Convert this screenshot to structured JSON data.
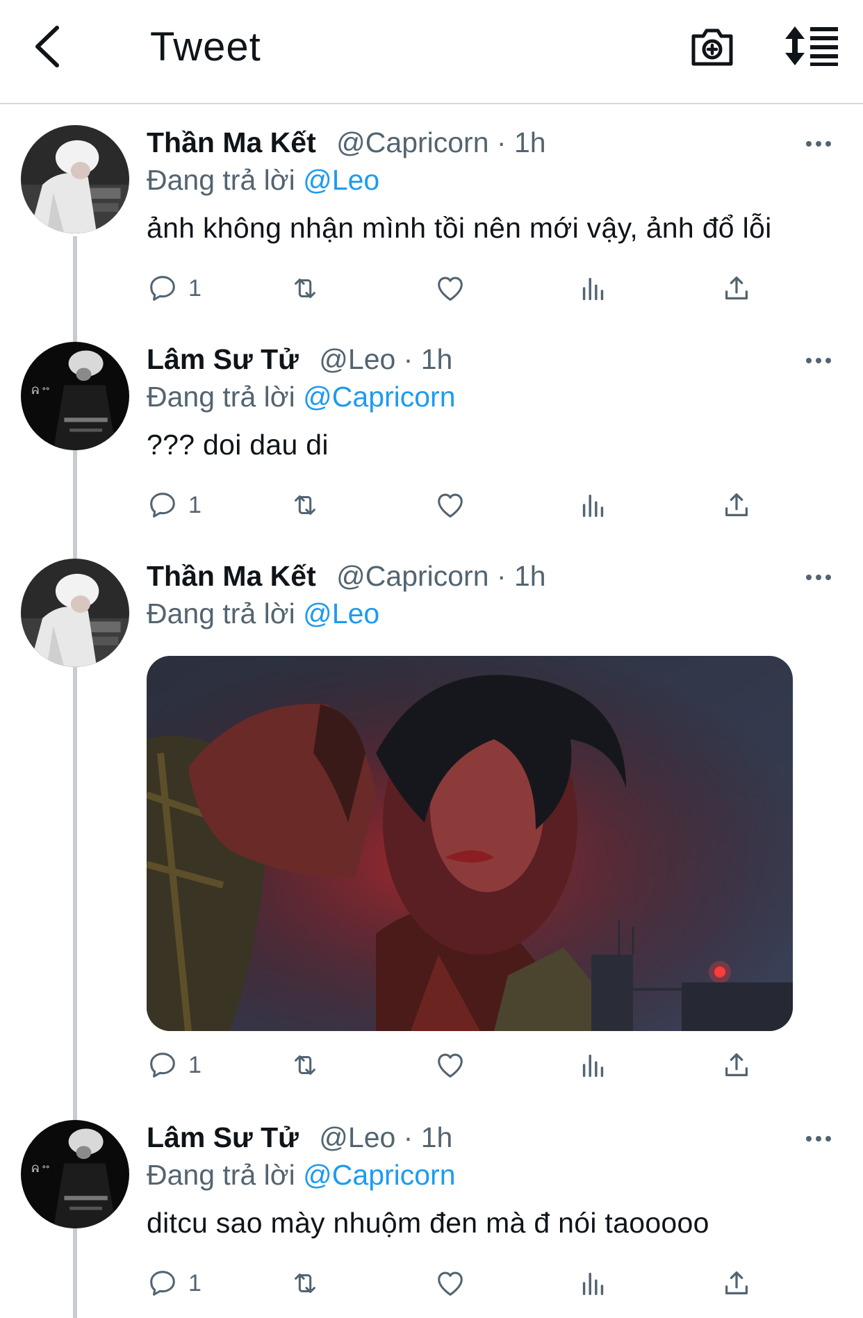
{
  "header": {
    "title": "Tweet",
    "icons": [
      "back-arrow-icon",
      "camera-plus-icon",
      "sort-icon"
    ]
  },
  "tweets": [
    {
      "name": "Thần Ma Kết",
      "handle": "@Capricorn · 1h",
      "reply_prefix": "Đang trả lời",
      "reply_to": "@Leo",
      "text": "ảnh không nhận mình tồi nên mới vậy, ảnh đổ lỗi",
      "reply_count": "1",
      "avatar": "white-hair-avatar"
    },
    {
      "name": "Lâm Sư Tử",
      "handle": "@Leo · 1h",
      "reply_prefix": "Đang trả lời",
      "reply_to": "@Capricorn",
      "text": "??? doi dau di",
      "reply_count": "1",
      "avatar": "dark-avatar"
    },
    {
      "name": "Thần Ma Kết",
      "handle": "@Capricorn · 1h",
      "reply_prefix": "Đang trả lời",
      "reply_to": "@Leo",
      "text": "",
      "reply_count": "1",
      "avatar": "white-hair-avatar",
      "media": "selfie-photo"
    },
    {
      "name": "Lâm Sư Tử",
      "handle": "@Leo · 1h",
      "reply_prefix": "Đang trả lời",
      "reply_to": "@Capricorn",
      "text": "ditcu sao mày nhuộm đen mà đ nói taooooo",
      "reply_count": "1",
      "avatar": "dark-avatar"
    }
  ],
  "colors": {
    "accent": "#1d9bf0",
    "secondary_text": "#536471",
    "primary_text": "#0f1419",
    "thread_line": "#c8ccd0"
  }
}
